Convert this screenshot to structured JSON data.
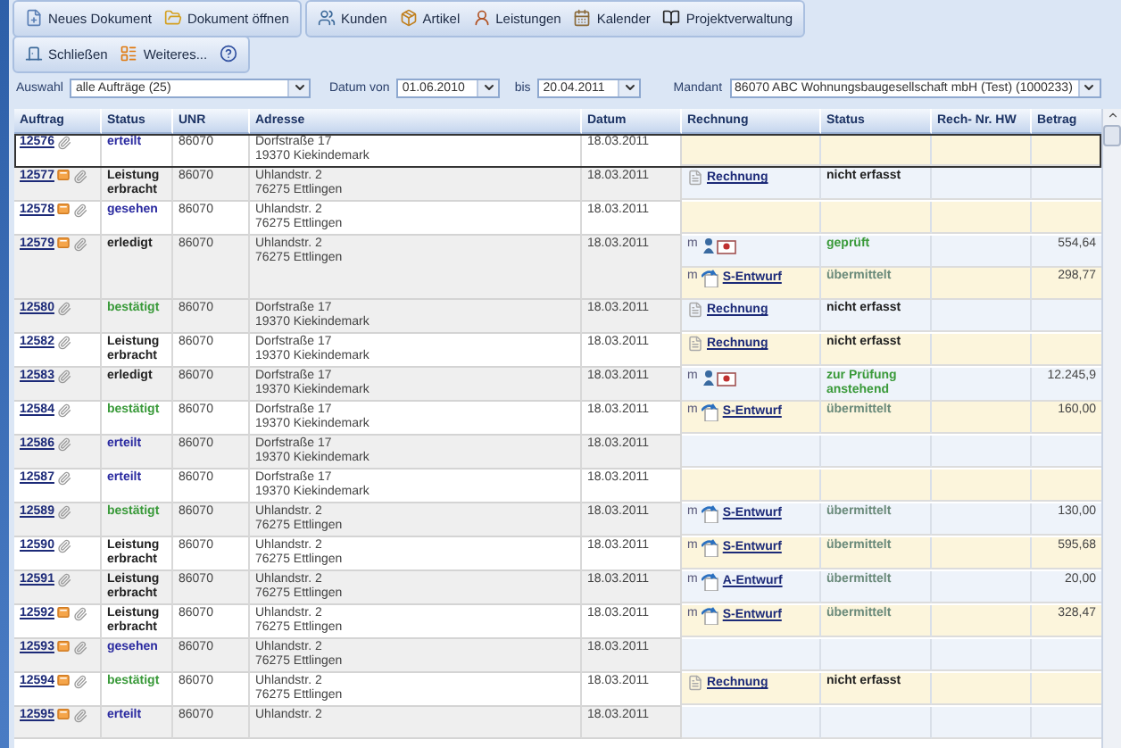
{
  "toolbar": {
    "groups": [
      [
        "Neues Dokument",
        "Dokument öffnen"
      ],
      [
        "Kunden",
        "Artikel",
        "Leistungen",
        "Kalender",
        "Projektverwaltung"
      ]
    ],
    "secondary": [
      "Schließen",
      "Weiteres..."
    ]
  },
  "filters": {
    "selection_label": "Auswahl",
    "selection": "alle Aufträge (25)",
    "from_label": "Datum von",
    "from": "01.06.2010",
    "to_label": "bis",
    "to": "20.04.2011",
    "client_label": "Mandant",
    "client": "86070 ABC Wohnungsbaugesellschaft mbH (Test) (1000233)"
  },
  "table": {
    "columns": [
      "Auftrag",
      "Status",
      "UNR",
      "Adresse",
      "Datum",
      "Rechnung",
      "Status",
      "Rech- Nr. HW",
      "Betrag"
    ],
    "rows": [
      {
        "order": "12576",
        "note": false,
        "selected": true,
        "status": {
          "text": "erteilt",
          "color": "#2a2aa0"
        },
        "unr": "86070",
        "address": [
          "Dorfstraße 17",
          "19370 Kiekindemark"
        ],
        "date": "18.03.2011"
      },
      {
        "order": "12577",
        "note": true,
        "selected": false,
        "status": {
          "text": "Leistung erbracht",
          "color": "#222222"
        },
        "unr": "86070",
        "address": [
          "Uhlandstr. 2",
          "76275 Ettlingen"
        ],
        "date": "18.03.2011",
        "invoices": [
          {
            "kind": "document",
            "link": "Rechnung",
            "status": {
              "text": "nicht erfasst",
              "color": "#222222"
            }
          }
        ]
      },
      {
        "order": "12578",
        "note": true,
        "selected": false,
        "status": {
          "text": "gesehen",
          "color": "#2a2aa0"
        },
        "unr": "86070",
        "address": [
          "Uhlandstr. 2",
          "76275 Ettlingen"
        ],
        "date": "18.03.2011"
      },
      {
        "order": "12579",
        "note": true,
        "selected": false,
        "status": {
          "text": "erledigt",
          "color": "#222222"
        },
        "unr": "86070",
        "address": [
          "Uhlandstr. 2",
          "76275 Ettlingen"
        ],
        "date": "18.03.2011",
        "invoices": [
          {
            "kind": "review",
            "prefix": "m",
            "status": {
              "text": "geprüft",
              "color": "#3a9a3a"
            },
            "amount": "554,64"
          },
          {
            "kind": "draft",
            "prefix": "m",
            "link": "S-Entwurf",
            "status": {
              "text": "übermittelt",
              "color": "#6a8a7a"
            },
            "amount": "298,77"
          }
        ]
      },
      {
        "order": "12580",
        "note": false,
        "selected": false,
        "status": {
          "text": "bestätigt",
          "color": "#3a9a3a"
        },
        "unr": "86070",
        "address": [
          "Dorfstraße 17",
          "19370 Kiekindemark"
        ],
        "date": "18.03.2011",
        "invoices": [
          {
            "kind": "document",
            "link": "Rechnung",
            "status": {
              "text": "nicht erfasst",
              "color": "#222222"
            }
          }
        ]
      },
      {
        "order": "12582",
        "note": false,
        "selected": false,
        "status": {
          "text": "Leistung erbracht",
          "color": "#222222"
        },
        "unr": "86070",
        "address": [
          "Dorfstraße 17",
          "19370 Kiekindemark"
        ],
        "date": "18.03.2011",
        "invoices": [
          {
            "kind": "document",
            "link": "Rechnung",
            "status": {
              "text": "nicht erfasst",
              "color": "#222222"
            }
          }
        ]
      },
      {
        "order": "12583",
        "note": false,
        "selected": false,
        "status": {
          "text": "erledigt",
          "color": "#222222"
        },
        "unr": "86070",
        "address": [
          "Dorfstraße 17",
          "19370 Kiekindemark"
        ],
        "date": "18.03.2011",
        "invoices": [
          {
            "kind": "review",
            "prefix": "m",
            "status": {
              "text": "zur Prüfung anstehend",
              "color": "#3a9a3a"
            },
            "amount": "12.245,9"
          }
        ]
      },
      {
        "order": "12584",
        "note": false,
        "selected": false,
        "status": {
          "text": "bestätigt",
          "color": "#3a9a3a"
        },
        "unr": "86070",
        "address": [
          "Dorfstraße 17",
          "19370 Kiekindemark"
        ],
        "date": "18.03.2011",
        "invoices": [
          {
            "kind": "draft",
            "prefix": "m",
            "link": "S-Entwurf",
            "status": {
              "text": "übermittelt",
              "color": "#6a8a7a"
            },
            "amount": "160,00"
          }
        ]
      },
      {
        "order": "12586",
        "note": false,
        "selected": false,
        "status": {
          "text": "erteilt",
          "color": "#2a2aa0"
        },
        "unr": "86070",
        "address": [
          "Dorfstraße 17",
          "19370 Kiekindemark"
        ],
        "date": "18.03.2011"
      },
      {
        "order": "12587",
        "note": false,
        "selected": false,
        "status": {
          "text": "erteilt",
          "color": "#2a2aa0"
        },
        "unr": "86070",
        "address": [
          "Dorfstraße 17",
          "19370 Kiekindemark"
        ],
        "date": "18.03.2011"
      },
      {
        "order": "12589",
        "note": false,
        "selected": false,
        "status": {
          "text": "bestätigt",
          "color": "#3a9a3a"
        },
        "unr": "86070",
        "address": [
          "Uhlandstr. 2",
          "76275 Ettlingen"
        ],
        "date": "18.03.2011",
        "invoices": [
          {
            "kind": "draft",
            "prefix": "m",
            "link": "S-Entwurf",
            "status": {
              "text": "übermittelt",
              "color": "#6a8a7a"
            },
            "amount": "130,00"
          }
        ]
      },
      {
        "order": "12590",
        "note": false,
        "selected": false,
        "status": {
          "text": "Leistung erbracht",
          "color": "#222222"
        },
        "unr": "86070",
        "address": [
          "Uhlandstr. 2",
          "76275 Ettlingen"
        ],
        "date": "18.03.2011",
        "invoices": [
          {
            "kind": "draft",
            "prefix": "m",
            "link": "S-Entwurf",
            "status": {
              "text": "übermittelt",
              "color": "#6a8a7a"
            },
            "amount": "595,68"
          }
        ]
      },
      {
        "order": "12591",
        "note": false,
        "selected": false,
        "status": {
          "text": "Leistung erbracht",
          "color": "#222222"
        },
        "unr": "86070",
        "address": [
          "Uhlandstr. 2",
          "76275 Ettlingen"
        ],
        "date": "18.03.2011",
        "invoices": [
          {
            "kind": "draft",
            "prefix": "m",
            "link": "A-Entwurf",
            "status": {
              "text": "übermittelt",
              "color": "#6a8a7a"
            },
            "amount": "20,00"
          }
        ]
      },
      {
        "order": "12592",
        "note": true,
        "selected": false,
        "status": {
          "text": "Leistung erbracht",
          "color": "#222222"
        },
        "unr": "86070",
        "address": [
          "Uhlandstr. 2",
          "76275 Ettlingen"
        ],
        "date": "18.03.2011",
        "invoices": [
          {
            "kind": "draft",
            "prefix": "m",
            "link": "S-Entwurf",
            "status": {
              "text": "übermittelt",
              "color": "#6a8a7a"
            },
            "amount": "328,47"
          }
        ]
      },
      {
        "order": "12593",
        "note": true,
        "selected": false,
        "status": {
          "text": "gesehen",
          "color": "#2a2aa0"
        },
        "unr": "86070",
        "address": [
          "Uhlandstr. 2",
          "76275 Ettlingen"
        ],
        "date": "18.03.2011"
      },
      {
        "order": "12594",
        "note": true,
        "selected": false,
        "status": {
          "text": "bestätigt",
          "color": "#3a9a3a"
        },
        "unr": "86070",
        "address": [
          "Uhlandstr. 2",
          "76275 Ettlingen"
        ],
        "date": "18.03.2011",
        "invoices": [
          {
            "kind": "document",
            "link": "Rechnung",
            "status": {
              "text": "nicht erfasst",
              "color": "#222222"
            }
          }
        ]
      },
      {
        "order": "12595",
        "note": true,
        "selected": false,
        "status": {
          "text": "erteilt",
          "color": "#2a2aa0"
        },
        "unr": "86070",
        "address": [
          "Uhlandstr. 2"
        ],
        "date": "18.03.2011"
      }
    ]
  }
}
